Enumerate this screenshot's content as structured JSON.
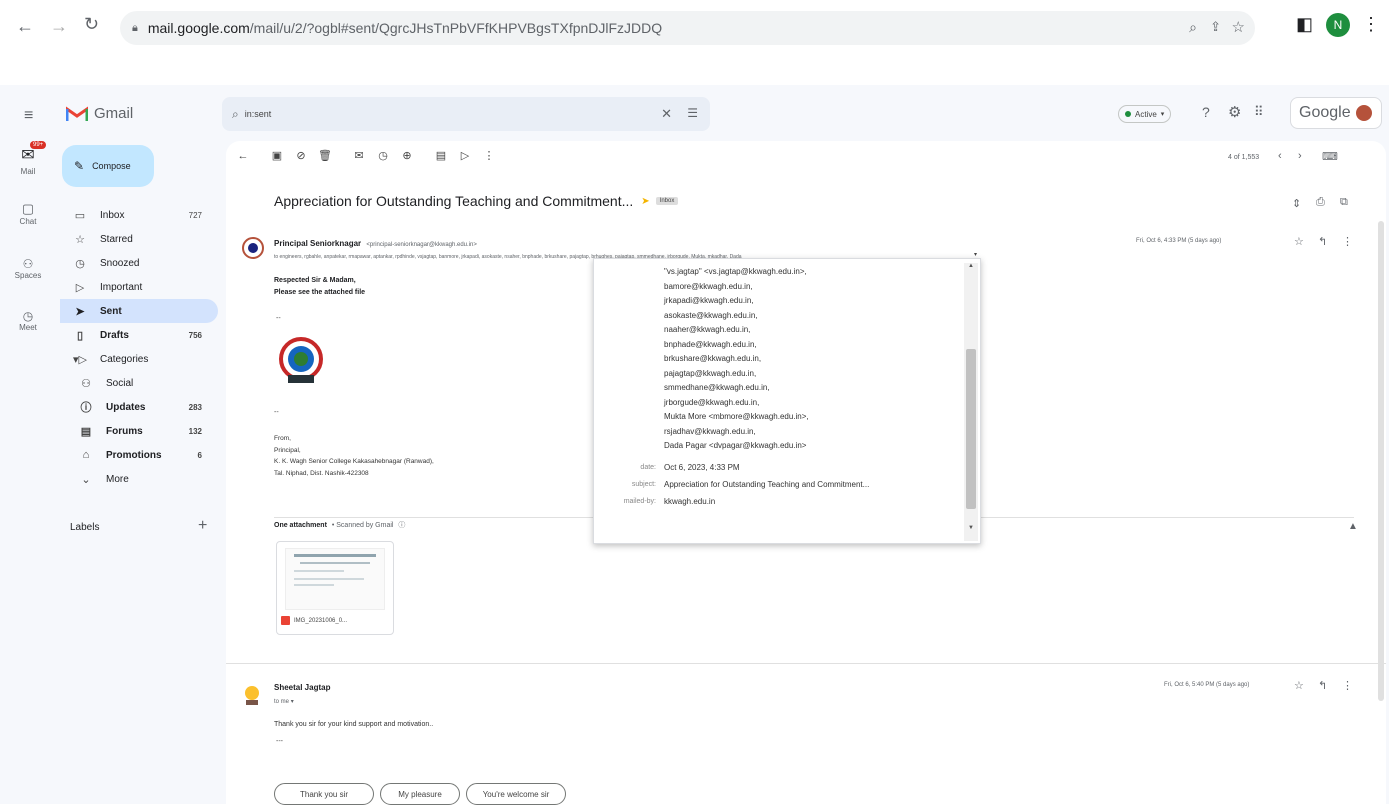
{
  "browser": {
    "url_host": "mail.google.com",
    "url_path": "/mail/u/2/?ogbl#sent/QgrcJHsTnPbVFfKHPVBgsTXfpnDJlFzJDDQ",
    "profile_initial": "N"
  },
  "app": {
    "name": "Gmail",
    "search_value": "in:sent",
    "status": "Active",
    "account_label": "Google"
  },
  "rail": [
    {
      "label": "Mail",
      "badge": "99+"
    },
    {
      "label": "Chat"
    },
    {
      "label": "Spaces"
    },
    {
      "label": "Meet"
    }
  ],
  "sidebar": {
    "compose_label": "Compose",
    "items": [
      {
        "label": "Inbox",
        "count": "727"
      },
      {
        "label": "Starred",
        "count": ""
      },
      {
        "label": "Snoozed",
        "count": ""
      },
      {
        "label": "Important",
        "count": ""
      },
      {
        "label": "Sent",
        "count": ""
      },
      {
        "label": "Drafts",
        "count": "756"
      },
      {
        "label": "Categories",
        "count": ""
      },
      {
        "label": "Social",
        "count": ""
      },
      {
        "label": "Updates",
        "count": "283"
      },
      {
        "label": "Forums",
        "count": "132"
      },
      {
        "label": "Promotions",
        "count": "6"
      },
      {
        "label": "More",
        "count": ""
      }
    ],
    "labels_heading": "Labels"
  },
  "toolbar": {
    "pagination": "4 of 1,553"
  },
  "thread": {
    "subject": "Appreciation for Outstanding Teaching and Commitment...",
    "tag": "Inbox",
    "message1": {
      "sender_name": "Principal Seniorknagar",
      "sender_email": "<principal-seniorknagar@kkwagh.edu.in>",
      "to_line": "to engineers, rgbahle, anpatekar, rmapawar, aptankar, rpdhinde, vsjagtap, banmore, jrkapadi, asokaste, nsaher, bnphade, brkushare, pajagtap, brhughes, pajagtap, smmedhane, jrborgude, Mukta, mkadhar, Dada",
      "date": "Fri, Oct 6, 4:33 PM (5 days ago)",
      "body_line1": "Respected Sir & Madam,",
      "body_line2": "Please see the attached file",
      "sig_dash": "--",
      "sig": [
        "From,",
        "Principal,",
        "K. K. Wagh Senior College Kakasahebnagar (Ranwad),",
        "Tal. Niphad, Dist. Nashik-422308"
      ],
      "attachment_heading": "One attachment",
      "attachment_scan": "• Scanned by Gmail",
      "attachment_name": "IMG_20231006_0..."
    },
    "message2": {
      "sender_name": "Sheetal Jagtap",
      "to_line": "to me",
      "date": "Fri, Oct 6, 5:40 PM (5 days ago)",
      "body": "Thank you sir for your kind support and motivation..",
      "sig_dash": "---",
      "reply_chips": [
        "Thank you sir",
        "My pleasure",
        "You're welcome sir"
      ]
    }
  },
  "details_popup": {
    "recipients": [
      "\"vs.jagtap\" <vs.jagtap@kkwagh.edu.in>,",
      "bamore@kkwagh.edu.in,",
      "jrkapadi@kkwagh.edu.in,",
      "asokaste@kkwagh.edu.in,",
      "naaher@kkwagh.edu.in,",
      "bnphade@kkwagh.edu.in,",
      "brkushare@kkwagh.edu.in,",
      "pajagtap@kkwagh.edu.in,",
      "smmedhane@kkwagh.edu.in,",
      "jrborgude@kkwagh.edu.in,",
      "Mukta More <mbmore@kkwagh.edu.in>,",
      "rsjadhav@kkwagh.edu.in,",
      "Dada Pagar <dvpagar@kkwagh.edu.in>"
    ],
    "date_label": "date:",
    "date_value": "Oct 6, 2023, 4:33 PM",
    "subject_label": "subject:",
    "subject_value": "Appreciation for Outstanding Teaching and Commitment...",
    "mailed_by_label": "mailed-by:",
    "mailed_by_value": "kkwagh.edu.in"
  },
  "colors": {
    "accent_blue": "#0b57d0",
    "sent_highlight": "#d3e3fd",
    "compose_bg": "#c2e7ff",
    "active_green": "#1e8e3e",
    "profile_green": "#1e8e3e",
    "gmail_red": "#ea4335"
  }
}
